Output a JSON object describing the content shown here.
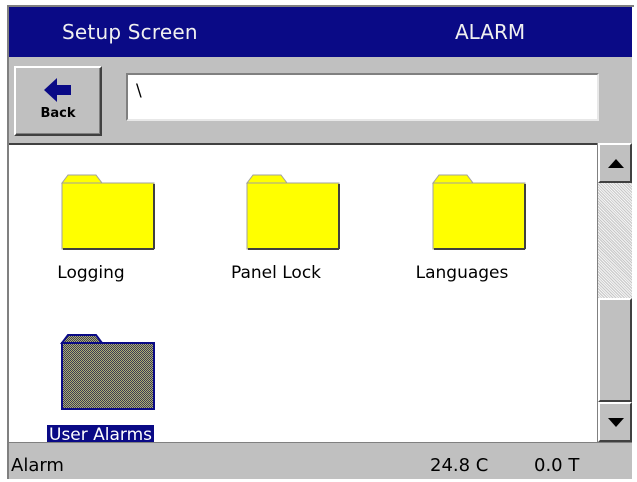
{
  "title_bar": {
    "title": "Setup Screen",
    "mode": "ALARM"
  },
  "toolbar": {
    "back_label": "Back",
    "back_icon": "left-arrow-icon",
    "path_value": "\\"
  },
  "folders": [
    {
      "label": "Logging",
      "icon": "folder-icon",
      "selected": false
    },
    {
      "label": "Panel Lock",
      "icon": "folder-icon",
      "selected": false
    },
    {
      "label": "Languages",
      "icon": "folder-icon",
      "selected": false
    },
    {
      "label": "User Alarms",
      "icon": "folder-icon",
      "selected": true
    }
  ],
  "scrollbar": {
    "up_icon": "scroll-up-arrow-icon",
    "down_icon": "scroll-down-arrow-icon"
  },
  "status_bar": {
    "status": "Alarm",
    "temperature": "24.8 C",
    "force": "0.0 T"
  },
  "colors": {
    "title_bar_bg": "#0a0a86",
    "folder_fill": "#ffff00",
    "folder_selected_fill": "#808040",
    "panel_gray": "#c0c0c0",
    "selection_bg": "#0a0a86"
  }
}
